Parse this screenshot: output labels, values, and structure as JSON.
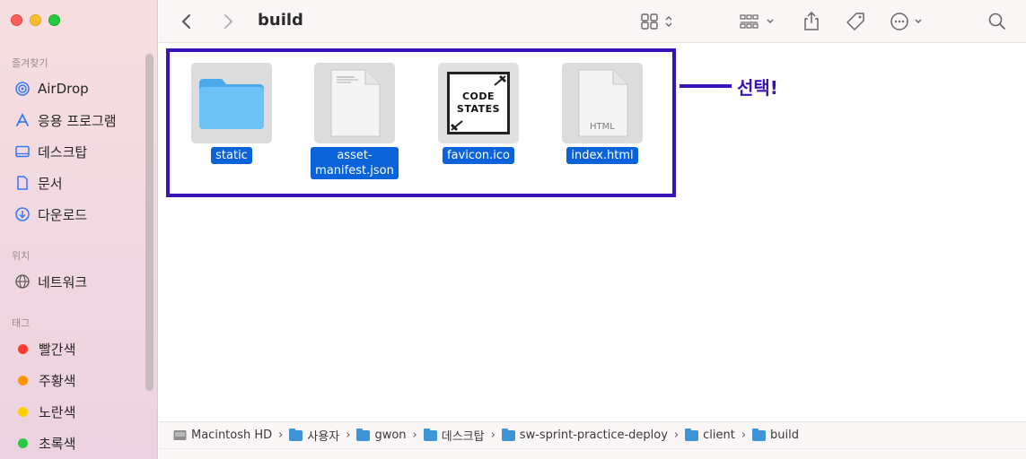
{
  "toolbar": {
    "title": "build",
    "back_icon": "chevron-left-icon",
    "forward_icon": "chevron-right-icon"
  },
  "sidebar": {
    "favorites_title": "즐겨찾기",
    "favorites": [
      {
        "label": "AirDrop",
        "icon": "airdrop-icon"
      },
      {
        "label": "응용 프로그램",
        "icon": "applications-icon"
      },
      {
        "label": "데스크탑",
        "icon": "desktop-icon"
      },
      {
        "label": "문서",
        "icon": "document-icon"
      },
      {
        "label": "다운로드",
        "icon": "download-icon"
      }
    ],
    "locations_title": "위치",
    "locations": [
      {
        "label": "네트워크",
        "icon": "network-icon"
      }
    ],
    "tags_title": "태그",
    "tags": [
      {
        "label": "빨간색",
        "color": "#ff3b30"
      },
      {
        "label": "주황색",
        "color": "#ff9500"
      },
      {
        "label": "노란색",
        "color": "#ffcc00"
      },
      {
        "label": "초록색",
        "color": "#28c840"
      }
    ]
  },
  "files": [
    {
      "name": "static",
      "type": "folder"
    },
    {
      "name_line1": "asset-",
      "name_line2": "manifest.json",
      "type": "json"
    },
    {
      "name": "favicon.ico",
      "type": "ico",
      "logo_line1": "CODE",
      "logo_line2": "STATES"
    },
    {
      "name": "index.html",
      "type": "html",
      "badge": "HTML"
    }
  ],
  "annotation": {
    "text": "선택!",
    "color": "#3a13b8"
  },
  "pathbar": [
    {
      "label": "Macintosh HD",
      "icon": "disk-icon"
    },
    {
      "label": "사용자",
      "icon": "folder-icon"
    },
    {
      "label": "gwon",
      "icon": "home-folder-icon"
    },
    {
      "label": "데스크탑",
      "icon": "folder-icon"
    },
    {
      "label": "sw-sprint-practice-deploy",
      "icon": "folder-icon"
    },
    {
      "label": "client",
      "icon": "folder-icon"
    },
    {
      "label": "build",
      "icon": "folder-icon"
    }
  ],
  "colors": {
    "selection": "#0b63d9",
    "accent": "#3a13b8"
  }
}
